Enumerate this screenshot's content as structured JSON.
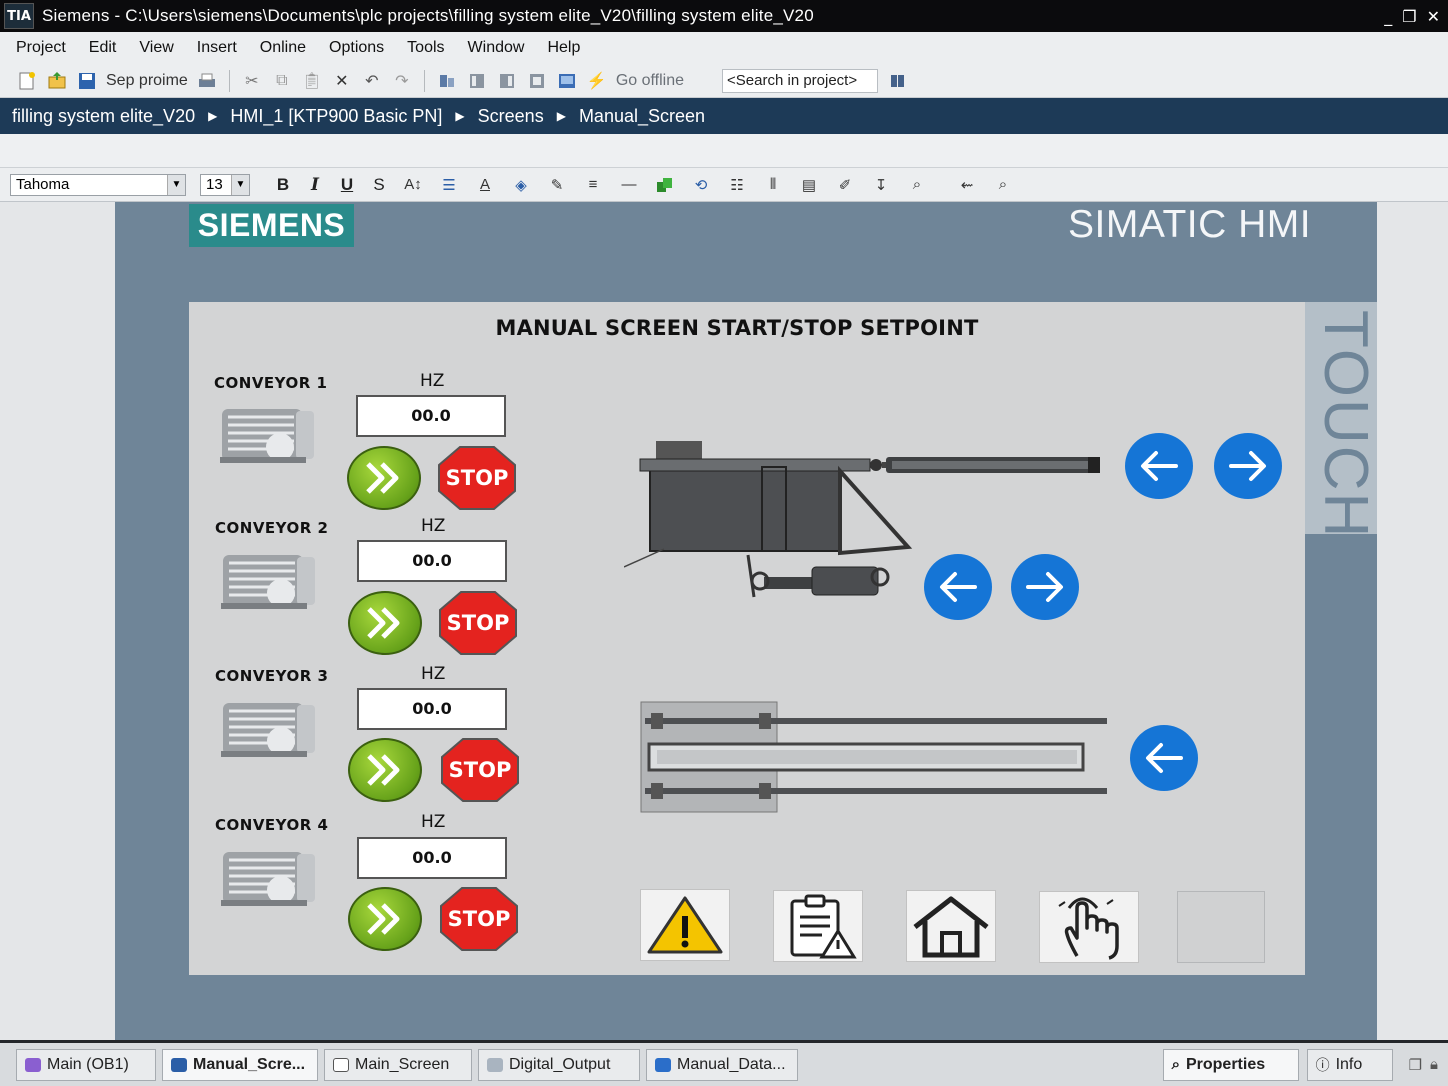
{
  "window": {
    "app_icon": "TIA",
    "title": "Siemens  -  C:\\Users\\siemens\\Documents\\plc projects\\filling system elite_V20\\filling system elite_V20",
    "controls": [
      "_",
      "❐",
      "✕"
    ]
  },
  "menu": [
    "Project",
    "Edit",
    "View",
    "Insert",
    "Online",
    "Options",
    "Tools",
    "Window",
    "Help"
  ],
  "toolbar": {
    "save_label": "Sep proime",
    "go_offline_label": "Go offline",
    "search_placeholder": "<Search in project>"
  },
  "breadcrumb": [
    "filling system elite_V20",
    "HMI_1 [KTP900 Basic PN]",
    "Screens",
    "Manual_Screen"
  ],
  "format_toolbar": {
    "font": "Tahoma",
    "size": "13",
    "bold": "B",
    "italic": "I",
    "underline": "U",
    "strike": "S"
  },
  "hmi": {
    "brand": "SIEMENS",
    "product": "SIMATIC HMI",
    "touch": "TOUCH",
    "screen_title": "MANUAL SCREEN START/STOP SETPOINT",
    "conveyors": [
      {
        "label": "CONVEYOR 1",
        "unit": "HZ",
        "value": "00.0",
        "stop": "STOP"
      },
      {
        "label": "CONVEYOR 2",
        "unit": "HZ",
        "value": "00.0",
        "stop": "STOP"
      },
      {
        "label": "CONVEYOR 3",
        "unit": "HZ",
        "value": "00.0",
        "stop": "STOP"
      },
      {
        "label": "CONVEYOR 4",
        "unit": "HZ",
        "value": "00.0",
        "stop": "STOP"
      }
    ],
    "colors": {
      "start": "#6aa51c",
      "stop": "#e4231f",
      "arrow": "#1575d6",
      "frame": "#6f8598"
    }
  },
  "tabs": [
    {
      "label": "Main (OB1)",
      "icon": "ob-icon"
    },
    {
      "label": "Manual_Scre...",
      "icon": "screen-icon",
      "active": true
    },
    {
      "label": "Main_Screen",
      "icon": "screen-icon"
    },
    {
      "label": "Digital_Output",
      "icon": "tag-table-icon"
    },
    {
      "label": "Manual_Data...",
      "icon": "data-block-icon"
    }
  ],
  "right_tabs": {
    "properties": "Properties",
    "info": "Info"
  }
}
